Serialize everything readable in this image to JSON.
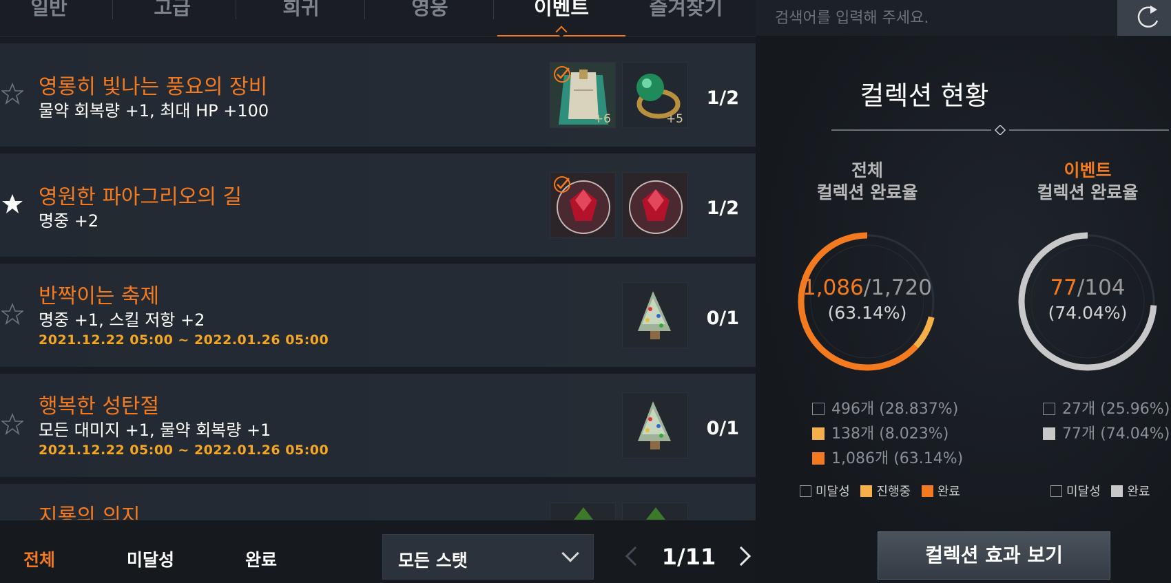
{
  "tabs": [
    {
      "label": "일반"
    },
    {
      "label": "고급"
    },
    {
      "label": "희귀"
    },
    {
      "label": "영웅"
    },
    {
      "label": "이벤트"
    },
    {
      "label": "즐겨찾기"
    }
  ],
  "active_tab": "이벤트",
  "collections": [
    {
      "title": "영롱히 빛나는 풍요의 장비",
      "effect": "물약 회복량 +1, 최대 HP +100",
      "date": "",
      "count": "1/2",
      "favorite": false,
      "items": [
        {
          "icon": "cloak-icon",
          "enhance": "+6",
          "registered": true
        },
        {
          "icon": "emerald-ring-icon",
          "enhance": "+5",
          "registered": false
        }
      ]
    },
    {
      "title": "영원한 파아그리오의 길",
      "effect": "명중 +2",
      "date": "",
      "count": "1/2",
      "favorite": true,
      "items": [
        {
          "icon": "ruby-gem-icon",
          "enhance": "",
          "registered": true
        },
        {
          "icon": "ruby-gem-icon",
          "enhance": "",
          "registered": false
        }
      ]
    },
    {
      "title": "반짝이는 축제",
      "effect": "명중 +1, 스킬 저항 +2",
      "date": "2021.12.22 05:00 ~ 2022.01.26 05:00",
      "count": "0/1",
      "favorite": false,
      "items": [
        {
          "icon": "christmas-tree-icon",
          "enhance": "",
          "registered": false
        }
      ]
    },
    {
      "title": "행복한 성탄절",
      "effect": "모든 대미지 +1, 물약 회복량 +1",
      "date": "2021.12.22 05:00 ~ 2022.01.26 05:00",
      "count": "0/1",
      "favorite": false,
      "items": [
        {
          "icon": "christmas-tree-icon",
          "enhance": "",
          "registered": false
        }
      ]
    },
    {
      "title": "지룡의 의지",
      "effect": "",
      "date": "",
      "count": "",
      "favorite": false,
      "items": [
        {
          "icon": "green-item-icon",
          "enhance": "",
          "registered": false
        },
        {
          "icon": "green-item-icon",
          "enhance": "",
          "registered": false
        }
      ]
    }
  ],
  "filters": {
    "all": "전체",
    "incomplete": "미달성",
    "complete": "완료",
    "active": "전체"
  },
  "stat_select": {
    "value": "모든 스탯"
  },
  "pagination": {
    "current": 1,
    "total": 11,
    "label": "1/11"
  },
  "search": {
    "placeholder": "검색어를 입력해 주세요."
  },
  "status_panel": {
    "title": "컬렉션 현황",
    "overall": {
      "heading_top": "전체",
      "heading_bottom": "컬렉션 완료율",
      "done": "1,086",
      "total": "/1,720",
      "percent": "(63.14%)",
      "fractions": {
        "incomplete": 0.28837,
        "in_progress": 0.08023,
        "complete": 0.6314
      },
      "stats": {
        "incomplete": "496개 (28.837%)",
        "in_progress": "138개 (8.023%)",
        "complete": "1,086개 (63.14%)"
      }
    },
    "event": {
      "heading_top": "이벤트",
      "heading_bottom": "컬렉션 완료율",
      "done": "77",
      "total": "/104",
      "percent": "(74.04%)",
      "fractions": {
        "incomplete": 0.2596,
        "complete": 0.7404
      },
      "stats": {
        "incomplete": "27개 (25.96%)",
        "complete": "77개 (74.04%)"
      }
    },
    "legend": {
      "incomplete": "미달성",
      "in_progress": "진행중",
      "complete": "완료"
    },
    "effect_button": "컬렉션 효과 보기"
  },
  "colors": {
    "accent": "#f47a1f",
    "in_progress": "#f5b04a",
    "event_complete": "#c8c8c8",
    "date": "#f5a623"
  }
}
